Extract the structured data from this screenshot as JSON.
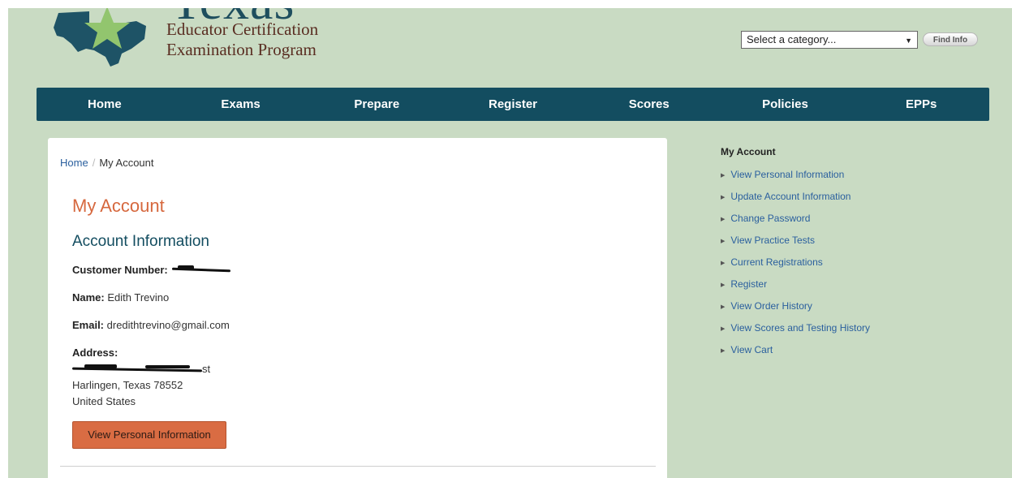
{
  "header": {
    "logo_word": "Texas",
    "logo_sub_line1": "Educator Certification",
    "logo_sub_line2": "Examination Program",
    "category_select": "Select a category...",
    "find_button": "Find Info"
  },
  "nav": [
    "Home",
    "Exams",
    "Prepare",
    "Register",
    "Scores",
    "Policies",
    "EPPs"
  ],
  "breadcrumb": {
    "home": "Home",
    "current": "My Account"
  },
  "main": {
    "title": "My Account",
    "section": "Account Information",
    "customer_label": "Customer Number:",
    "customer_value": "",
    "name_label": "Name:",
    "name_value": "Edith Trevino",
    "email_label": "Email:",
    "email_value": "dredithtrevino@gmail.com",
    "address_label": "Address:",
    "address_line1": "st",
    "address_line2": "Harlingen, Texas 78552",
    "address_line3": "United States",
    "button": "View Personal Information"
  },
  "sidebar": {
    "heading": "My Account",
    "items": [
      "View Personal Information",
      "Update Account Information",
      "Change Password",
      "View Practice Tests",
      "Current Registrations",
      "Register",
      "View Order History",
      "View Scores and Testing History",
      "View Cart"
    ]
  },
  "colors": {
    "background": "#c9dbc3",
    "nav": "#134d60",
    "accent": "#d96c43",
    "title": "#d6683e",
    "link": "#2a5f9e"
  }
}
